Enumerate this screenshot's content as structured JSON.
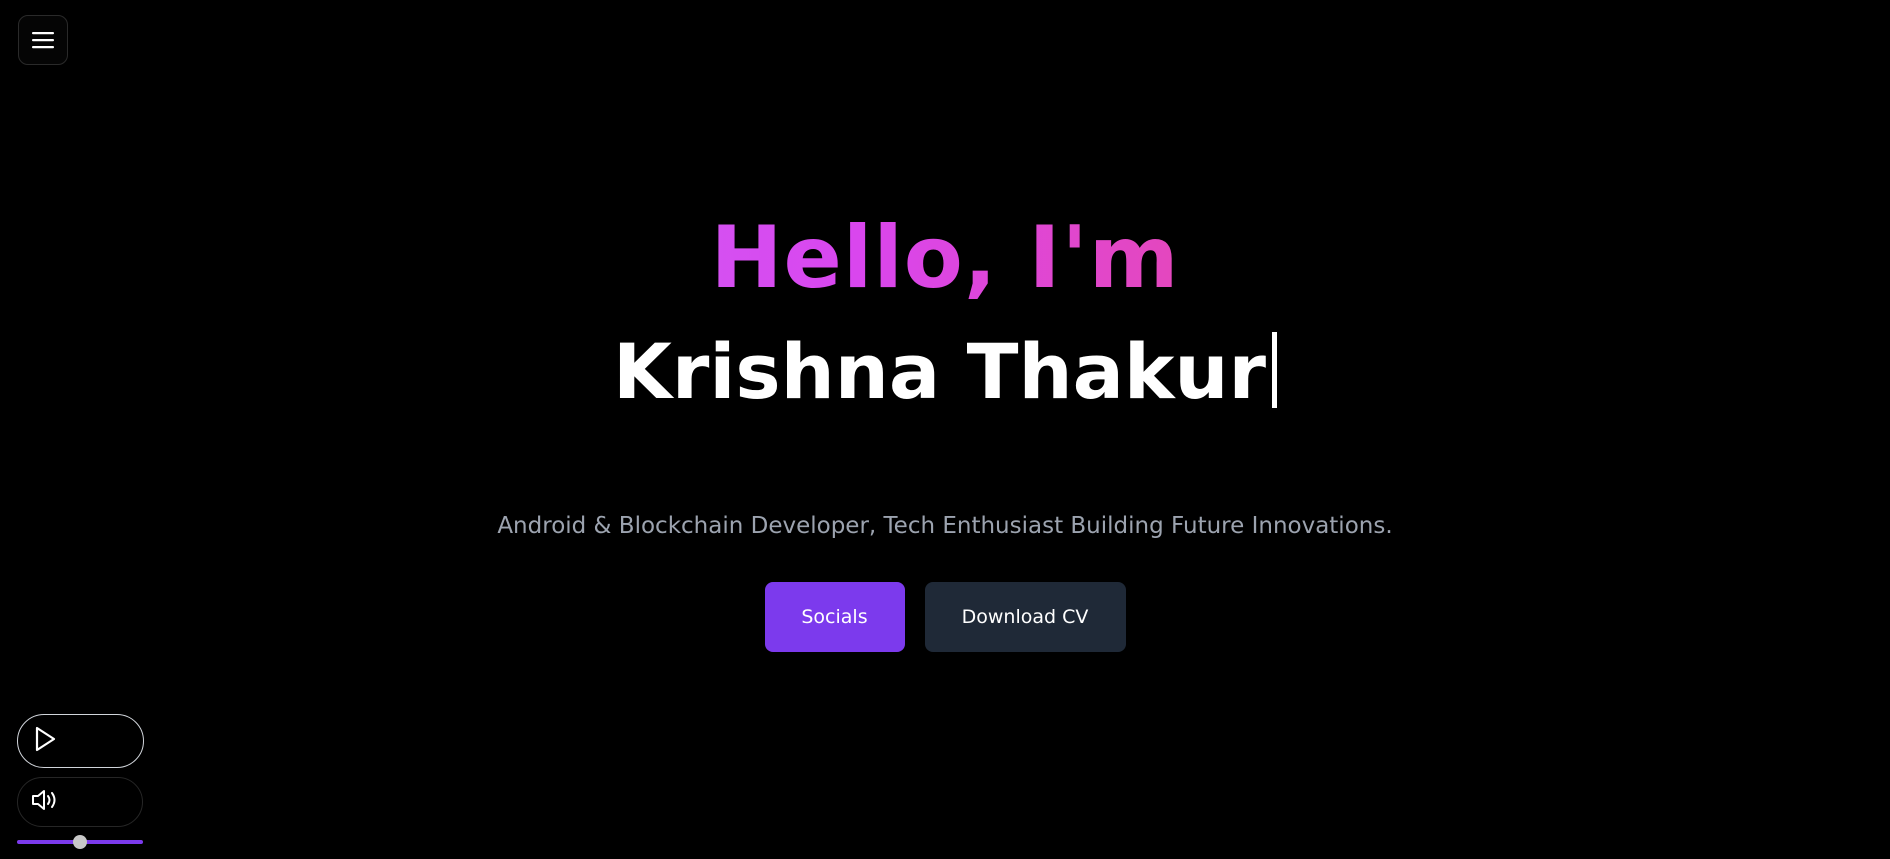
{
  "menu": {
    "icon": "hamburger-menu-icon"
  },
  "hero": {
    "greeting": "Hello, I'm",
    "name": "Krishna Thakur",
    "tagline": "Android & Blockchain Developer, Tech Enthusiast Building Future Innovations."
  },
  "actions": {
    "socials_label": "Socials",
    "download_cv_label": "Download CV"
  },
  "player": {
    "play_icon": "play-icon",
    "volume_icon": "volume-icon",
    "volume_level": 0.5
  },
  "colors": {
    "background": "#000000",
    "accent": "#7c3aed",
    "secondary_button": "#1f2937",
    "gradient_start": "#c084fc",
    "gradient_end": "#db2777",
    "tagline_text": "#9ca3af"
  }
}
